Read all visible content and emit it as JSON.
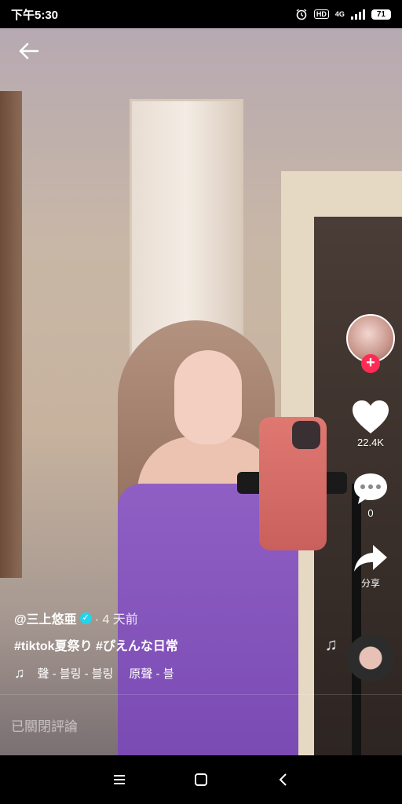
{
  "status_bar": {
    "time": "下午5:30",
    "hd_label": "HD",
    "network": "4G",
    "battery": "71"
  },
  "video": {
    "author": "@三上悠亜",
    "time_ago": "· 4 天前",
    "hashtags": "#tiktok夏祭り #ぴえんな日常",
    "music_track": "聲 - 블링 - 블링",
    "music_original": "原聲 - 블"
  },
  "actions": {
    "likes": "22.4K",
    "comments": "0",
    "share_label": "分享",
    "follow_symbol": "+"
  },
  "comment_bar": {
    "text": "已關閉評論"
  },
  "icons": {
    "back": "back-arrow-icon",
    "like": "heart-icon",
    "comment": "comment-bubble-icon",
    "share": "share-arrow-icon",
    "music": "music-note-icon"
  },
  "colors": {
    "accent": "#fe2c55",
    "verified": "#20d5ec",
    "dress": "#8f5fc4"
  }
}
